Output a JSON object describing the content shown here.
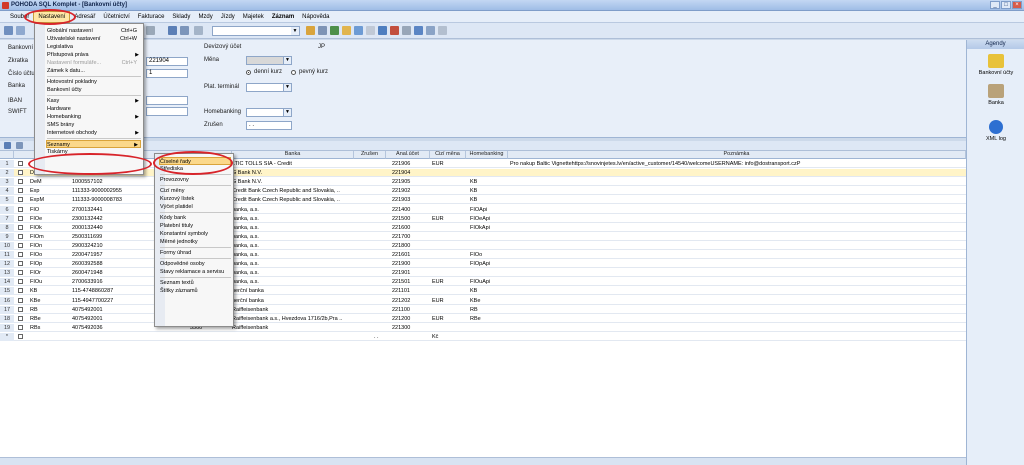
{
  "title": "POHODA SQL Komplet - [Bankovní účty]",
  "window_buttons": [
    "_",
    "□",
    "×"
  ],
  "menubar": [
    "Soubor",
    "Nastavení",
    "Adresář",
    "Účetnictví",
    "Fakturace",
    "Sklady",
    "Mzdy",
    "Jízdy",
    "Majetek",
    "Záznam",
    "Nápověda"
  ],
  "form": {
    "left_labels": [
      "Bankovní",
      "Zkratka",
      "Číslo účtu",
      "Banka",
      "IBAN",
      "SWIFT"
    ],
    "ucet_value": "221904",
    "poradi_value": "1",
    "devizovy_ucet": "Devizový účet",
    "jp": "JP",
    "mena": "Měna",
    "denni_kurz": "denní kurz",
    "pevny_kurz": "pevný kurz",
    "plat_terminal": "Plat. terminál",
    "homebanking": "Homebanking",
    "zruseno": "Zrušen",
    "zruseno_value": ". ."
  },
  "grid": {
    "headers": [
      "Banka",
      "Zrušen",
      "Anal.účet",
      "Cizí měna",
      "Homebanking",
      "Poznámka"
    ],
    "rows": [
      {
        "n": "1",
        "zk": "",
        "ucet": "",
        "banka": "LTIC TOLLS SIA - Credit",
        "anal": "221906",
        "mena": "EUR",
        "hb": "",
        "pozn": "Pro nakup Baltic Vignettehttps://snovinjetes.lv/en/active_customer/14540/welcomeUSERNAME: info@dostransport.czP"
      },
      {
        "n": "2",
        "zk": "Db",
        "ucet": "1000557102",
        "banka": "G Bank N.V.",
        "anal": "221904",
        "mena": "",
        "hb": "",
        "pozn": ""
      },
      {
        "n": "3",
        "zk": "DeM",
        "ucet": "1000557102",
        "banka": "G Bank N.V.",
        "anal": "221905",
        "mena": "",
        "hb": "KB",
        "pozn": ""
      },
      {
        "n": "4",
        "zk": "Exp",
        "ucet": "111333-9000002955",
        "banka": "Credit Bank Czech Republic and Slovakia, ..",
        "anal": "221902",
        "mena": "",
        "hb": "KB",
        "pozn": ""
      },
      {
        "n": "5",
        "zk": "ExpM",
        "ucet": "111333-9000008783",
        "banka": "Credit Bank Czech Republic and Slovakia, ..",
        "anal": "221903",
        "mena": "",
        "hb": "KB",
        "pozn": ""
      },
      {
        "n": "6",
        "zk": "FIO",
        "ucet": "2700132441",
        "banka": "banka, a.s.",
        "anal": "221400",
        "mena": "",
        "hb": "FIOApi",
        "pozn": ""
      },
      {
        "n": "7",
        "zk": "FIOe",
        "ucet": "2300132442",
        "banka": "banka, a.s.",
        "anal": "221500",
        "mena": "EUR",
        "hb": "FIOeApi",
        "pozn": ""
      },
      {
        "n": "8",
        "zk": "FIOk",
        "ucet": "2000132440",
        "banka": "banka, a.s.",
        "anal": "221600",
        "mena": "",
        "hb": "FIOkApi",
        "pozn": ""
      },
      {
        "n": "9",
        "zk": "FIOm",
        "ucet": "2500311699",
        "banka": "banka, a.s.",
        "anal": "221700",
        "mena": "",
        "hb": "",
        "pozn": ""
      },
      {
        "n": "10",
        "zk": "FIOn",
        "ucet": "2900324210",
        "banka": "banka, a.s.",
        "anal": "221800",
        "mena": "",
        "hb": "",
        "pozn": ""
      },
      {
        "n": "11",
        "zk": "FIOo",
        "ucet": "2200471957",
        "banka": "banka, a.s.",
        "anal": "221601",
        "mena": "",
        "hb": "FIOo",
        "pozn": ""
      },
      {
        "n": "12",
        "zk": "FIOp",
        "ucet": "2600392588",
        "banka": "banka, a.s.",
        "anal": "221900",
        "mena": "",
        "hb": "FIOpApi",
        "pozn": ""
      },
      {
        "n": "13",
        "zk": "FIOr",
        "ucet": "2600471948",
        "banka": "banka, a.s.",
        "anal": "221901",
        "mena": "",
        "hb": "",
        "pozn": ""
      },
      {
        "n": "14",
        "zk": "FIOu",
        "ucet": "2700633916",
        "banka": "banka, a.s.",
        "anal": "221501",
        "mena": "EUR",
        "hb": "FIOuApi",
        "pozn": ""
      },
      {
        "n": "15",
        "zk": "KB",
        "ucet": "115-4748860287",
        "banka": "nerční banka",
        "anal": "221101",
        "mena": "",
        "hb": "KB",
        "pozn": ""
      },
      {
        "n": "16",
        "zk": "KBe",
        "ucet": "115-4947700227",
        "banka": "nerční banka",
        "anal": "221202",
        "mena": "EUR",
        "hb": "KBe",
        "pozn": ""
      },
      {
        "n": "17",
        "zk": "RB",
        "ucet": "4075492001",
        "banka": "Raiffeisenbank",
        "anal": "221100",
        "mena": "",
        "hb": "RB",
        "pozn": ""
      },
      {
        "n": "18",
        "zk": "RBe",
        "ucet": "4075492001",
        "kod": "5500",
        "banka": "Raiffeisenbank a.s., Hvezdova 1716/2b,Pra ..",
        "anal": "221200",
        "mena": "EUR",
        "hb": "RBe",
        "pozn": ""
      },
      {
        "n": "19",
        "zk": "RBs",
        "ucet": "4075492036",
        "kod": "5500",
        "banka": "Raiffeisenbank",
        "anal": "221300",
        "mena": "",
        "hb": "",
        "pozn": ""
      },
      {
        "n": "*",
        "zk": "",
        "ucet": "",
        "banka": "",
        "zrus": ". .",
        "anal": "",
        "mena": "Kč",
        "hb": "",
        "pozn": ""
      }
    ]
  },
  "menu_nastaveni": [
    {
      "label": "Globální nastavení",
      "shortcut": "Ctrl+G"
    },
    {
      "label": "Uživatelské nastavení",
      "shortcut": "Ctrl+W"
    },
    {
      "label": "Legislativa"
    },
    {
      "label": "Přístupová práva",
      "sub": true
    },
    {
      "label": "Nastavení formuláře...",
      "shortcut": "Ctrl+Y",
      "disabled": true
    },
    {
      "label": "Zámek k datu..."
    },
    {
      "sep": true
    },
    {
      "label": "Hotovostní pokladny"
    },
    {
      "label": "Bankovní účty"
    },
    {
      "sep": true
    },
    {
      "label": "Kasy",
      "sub": true
    },
    {
      "label": "Hardware"
    },
    {
      "label": "Homebanking",
      "sub": true
    },
    {
      "label": "SMS brány"
    },
    {
      "label": "Internetové obchody",
      "sub": true
    },
    {
      "sep": true
    },
    {
      "label": "Seznamy",
      "sub": true,
      "highlight": true
    },
    {
      "label": "Tiskárny"
    }
  ],
  "menu_seznamy": [
    {
      "label": "Číselné řady",
      "highlight": true
    },
    {
      "label": "Střediska"
    },
    {
      "sep": true
    },
    {
      "label": "Provozovny"
    },
    {
      "sep": true
    },
    {
      "label": "Cizí měny"
    },
    {
      "label": "Kurzový lístek"
    },
    {
      "label": "Výčet platidel"
    },
    {
      "sep": true
    },
    {
      "label": "Kódy bank"
    },
    {
      "label": "Platební tituly"
    },
    {
      "label": "Konstantní symboly"
    },
    {
      "label": "Měrné jednotky"
    },
    {
      "sep": true
    },
    {
      "label": "Formy úhrad"
    },
    {
      "sep": true
    },
    {
      "label": "Odpovědné osoby"
    },
    {
      "label": "Stavy reklamace a servisu"
    },
    {
      "sep": true
    },
    {
      "label": "Seznam textů"
    },
    {
      "label": "Štítky záznamů"
    }
  ],
  "agendy": {
    "title": "Agendy",
    "items": [
      {
        "label": "Bankovní účty",
        "icon": "bank-accounts-icon",
        "color": "#e8c23a"
      },
      {
        "label": "Banka",
        "icon": "bank-icon",
        "color": "#b9a27a"
      },
      {
        "label": "XML log",
        "icon": "xml-log-icon",
        "color": "#2d6fd1"
      }
    ]
  },
  "colors": {
    "menu_highlight": "#fbd88a",
    "annotation": "#d8242a"
  }
}
